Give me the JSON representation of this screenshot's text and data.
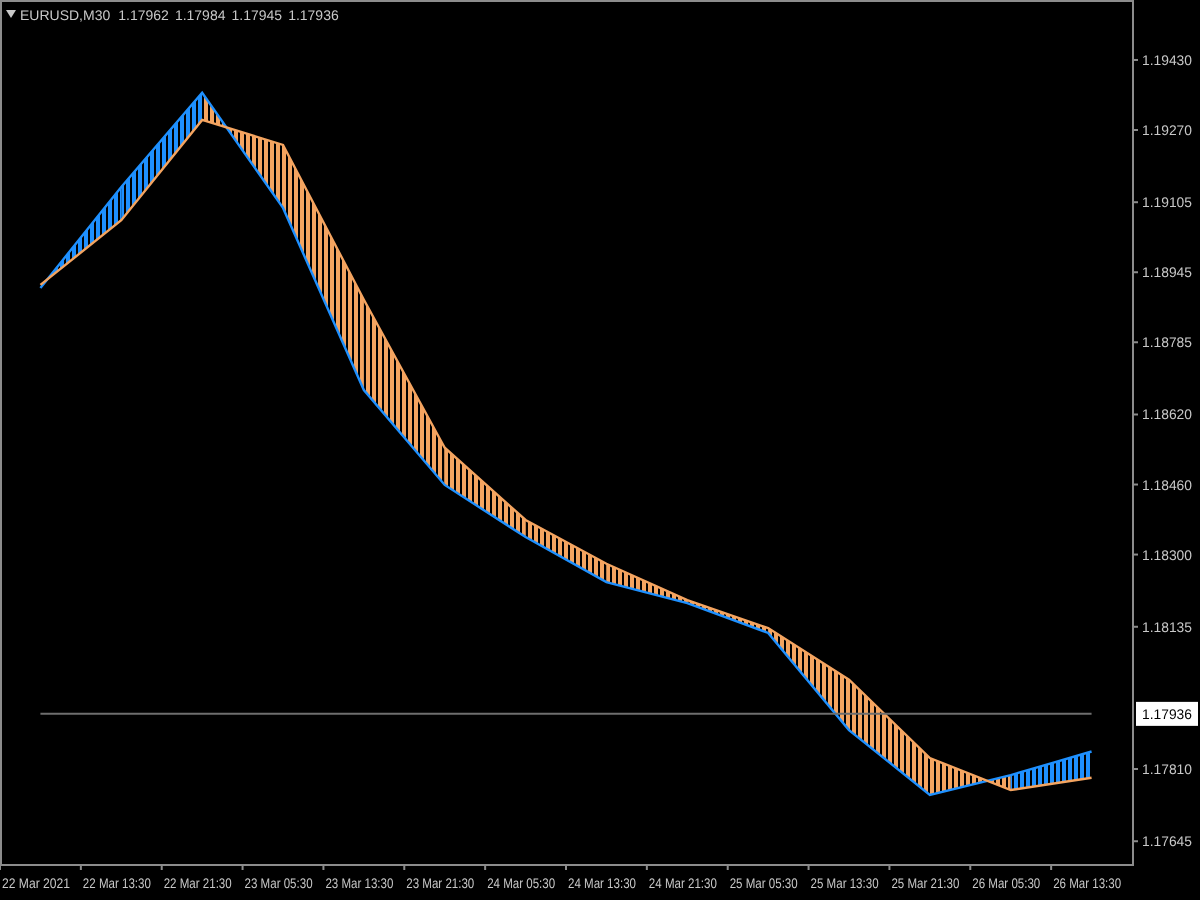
{
  "header": {
    "symbol": "EURUSD,M30",
    "quotes": [
      "1.17962",
      "1.17984",
      "1.17945",
      "1.17936"
    ]
  },
  "chart": {
    "chart_data": {
      "type": "line",
      "categories": [
        "22 Mar 2021",
        "22 Mar 13:30",
        "22 Mar 21:30",
        "23 Mar 05:30",
        "23 Mar 13:30",
        "23 Mar 21:30",
        "24 Mar 05:30",
        "24 Mar 13:30",
        "24 Mar 21:30",
        "25 Mar 05:30",
        "25 Mar 13:30",
        "25 Mar 21:30",
        "26 Mar 05:30",
        "26 Mar 13:30"
      ],
      "series": [
        {
          "color": "#1e90ff",
          "values": [
            1.18909,
            1.1914,
            1.19355,
            1.19092,
            1.18676,
            1.18459,
            1.1834,
            1.18237,
            1.18189,
            1.18121,
            1.17899,
            1.17751,
            1.17796,
            1.1785
          ]
        },
        {
          "color": "#f4a460",
          "values": [
            1.18916,
            1.19064,
            1.19293,
            1.19236,
            1.18882,
            1.18544,
            1.18379,
            1.18279,
            1.18196,
            1.18132,
            1.18014,
            1.17835,
            1.17762,
            1.1779
          ]
        },
        {
          "color": "#6e6e6e",
          "values": [
            1.17936,
            1.17936,
            1.17936,
            1.17936,
            1.17936,
            1.17936,
            1.17936,
            1.17936,
            1.17936,
            1.17936,
            1.17936,
            1.17936,
            1.17936,
            1.17936
          ]
        }
      ],
      "ylim": [
        1.17593,
        1.19567
      ],
      "yticks": [
        {
          "value": 1.1943,
          "label": "1.19430"
        },
        {
          "value": 1.1927,
          "label": "1.19270"
        },
        {
          "value": 1.19105,
          "label": "1.19105"
        },
        {
          "value": 1.18945,
          "label": "1.18945"
        },
        {
          "value": 1.18785,
          "label": "1.18785"
        },
        {
          "value": 1.1862,
          "label": "1.18620"
        },
        {
          "value": 1.1846,
          "label": "1.18460"
        },
        {
          "value": 1.183,
          "label": "1.18300"
        },
        {
          "value": 1.18135,
          "label": "1.18135"
        },
        {
          "value": 1.1781,
          "label": "1.17810"
        },
        {
          "value": 1.17645,
          "label": "1.17645"
        }
      ]
    },
    "price_axis": {
      "current_price": "1.17936"
    }
  }
}
